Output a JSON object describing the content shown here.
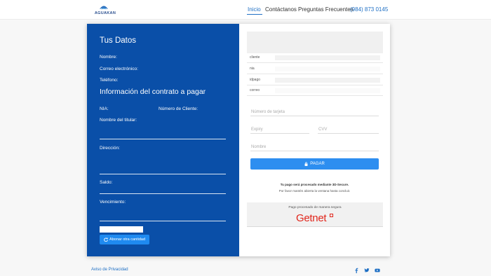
{
  "header": {
    "logo_text": "AGUAKAN",
    "nav": {
      "inicio": "Inicio",
      "contactanos": "Contáctanos",
      "preguntas": "Preguntas Frecuentes",
      "phone": "(984) 873 0145"
    }
  },
  "left": {
    "datos_title": "Tus Datos",
    "nombre_label": "Nombre:",
    "correo_label": "Correo electrónico:",
    "telefono_label": "Teléfono:",
    "contrato_title": "Información del contrato a pagar",
    "nia_label": "NIA:",
    "cliente_label": "Número de Cliente:",
    "titular_label": "Nombre del titular:",
    "direccion_label": "Dirección:",
    "saldo_label": "Saldo:",
    "vencimiento_label": "Vencimiento:",
    "abonar_button": "Abonar otra cantidad"
  },
  "right": {
    "rows": {
      "cliente": "cliente",
      "nia": "nia",
      "idpago": "idpago",
      "correo": "correo"
    },
    "card_number_placeholder": "Número de tarjeta",
    "expiry_placeholder": "Expiry",
    "cvv_placeholder": "CVV",
    "name_placeholder": "Nombre",
    "pay_button": "PAGAR",
    "note1": "Tu pago será procesado mediante 3D-Secure.",
    "note2": "Por favor mantén abierta la ventana hasta concluir.",
    "secure_text": "Pago procesado de manera segura",
    "getnet_logo": "Getnet"
  },
  "footer": {
    "privacy_link": "Aviso de Privacidad"
  },
  "colors": {
    "primary_blue": "#0a4fa8",
    "accent_blue": "#1e6fc4",
    "button_blue": "#2d8ef0",
    "getnet_red": "#e1251b"
  },
  "icons": {
    "lock": "lock-icon",
    "refresh": "refresh-icon",
    "facebook": "facebook-icon",
    "twitter": "twitter-icon",
    "youtube": "youtube-icon"
  }
}
